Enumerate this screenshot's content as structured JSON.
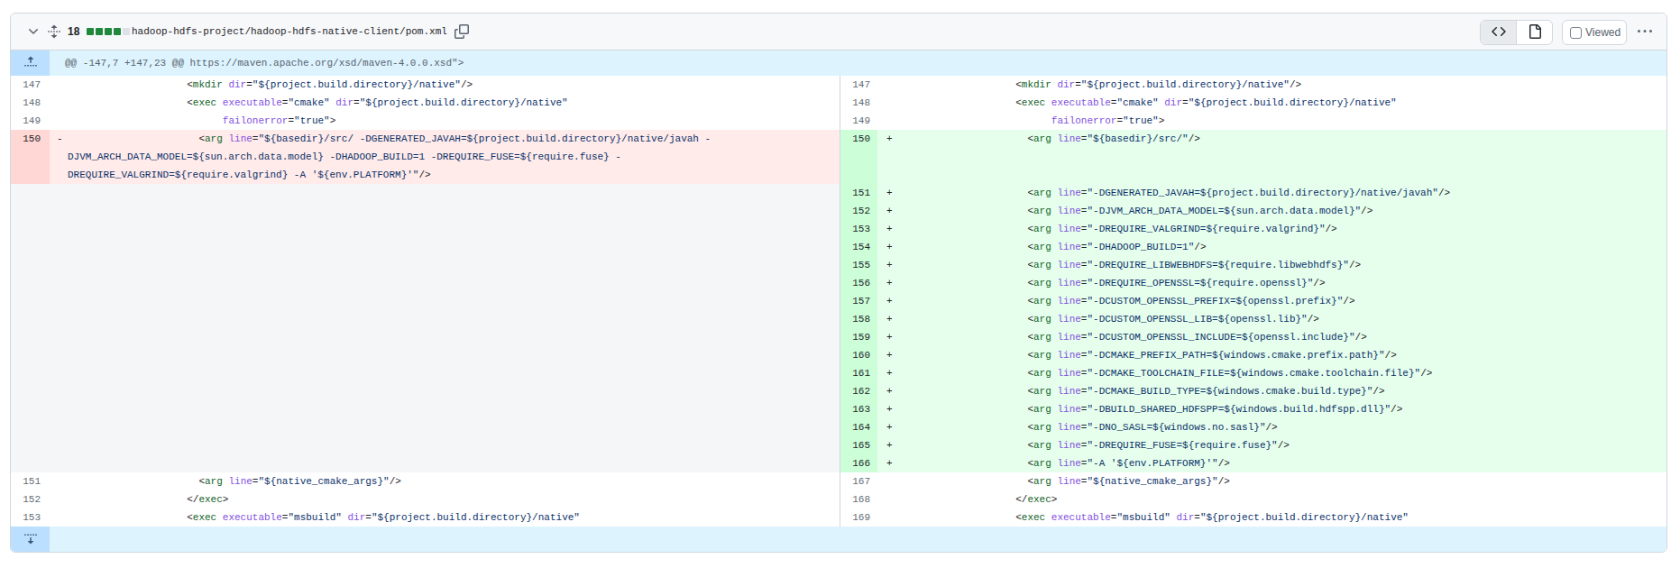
{
  "file_header": {
    "changes_count": "18",
    "diffstat_blocks": [
      "added",
      "added",
      "added",
      "added",
      "neutral"
    ],
    "file_path": "hadoop-hdfs-project/hadoop-hdfs-native-client/pom.xml",
    "viewed_label": "Viewed",
    "icons": [
      "chevron-down-icon",
      "unfold-icon",
      "copy-icon",
      "code-view-icon",
      "rich-diff-icon",
      "kebab-horizontal-icon"
    ]
  },
  "colors": {
    "border": "#d0d7de",
    "header_bg": "#f6f8fa",
    "diffstat_added": "#1f883d",
    "diffstat_neutral": "#dde2e8",
    "hunk_bg": "#ddf4ff",
    "hunk_gutter_bg": "#bbdfff",
    "addition_line_bg": "#e6ffec",
    "addition_num_bg": "#ccffd8",
    "deletion_line_bg": "#ffebe9",
    "deletion_num_bg": "#ffd7d5",
    "empty_cell_bg": "#f4f6f8",
    "syntax_tag": "#116329",
    "syntax_attr": "#8250df",
    "syntax_string": "#0a3069",
    "syntax_punct": "#1f2328"
  },
  "diff_rows": [
    {
      "type": "hunk",
      "text": "@@ -147,7 +147,23 @@ https://maven.apache.org/xsd/maven-4.0.0.xsd\">"
    },
    {
      "type": "pair",
      "left": {
        "num": "147",
        "kind": "ctx",
        "lines": [
          "                    <mkdir dir=\"${project.build.directory}/native\"/>"
        ]
      },
      "right": {
        "num": "147",
        "kind": "ctx",
        "lines": [
          "                    <mkdir dir=\"${project.build.directory}/native\"/>"
        ]
      }
    },
    {
      "type": "pair",
      "left": {
        "num": "148",
        "kind": "ctx",
        "lines": [
          "                    <exec executable=\"cmake\" dir=\"${project.build.directory}/native\""
        ]
      },
      "right": {
        "num": "148",
        "kind": "ctx",
        "lines": [
          "                    <exec executable=\"cmake\" dir=\"${project.build.directory}/native\""
        ]
      }
    },
    {
      "type": "pair",
      "left": {
        "num": "149",
        "kind": "ctx",
        "lines": [
          "                          failonerror=\"true\">"
        ]
      },
      "right": {
        "num": "149",
        "kind": "ctx",
        "lines": [
          "                          failonerror=\"true\">"
        ]
      }
    },
    {
      "type": "pair",
      "left": {
        "num": "150",
        "kind": "del",
        "marker": "-",
        "lines": [
          "                      <arg line=\"${basedir}/src/ -DGENERATED_JAVAH=${project.build.directory}/native/javah -",
          "DJVM_ARCH_DATA_MODEL=${sun.arch.data.model} -DHADOOP_BUILD=1 -DREQUIRE_FUSE=${require.fuse} -",
          "DREQUIRE_VALGRIND=${require.valgrind} -A '${env.PLATFORM}'\"/>"
        ]
      },
      "right": {
        "num": "150",
        "kind": "add",
        "marker": "+",
        "lines": [
          "                      <arg line=\"${basedir}/src/\"/>"
        ]
      }
    },
    {
      "type": "pair",
      "left": {
        "kind": "empty",
        "lines": []
      },
      "right": {
        "num": "151",
        "kind": "add",
        "marker": "+",
        "lines": [
          "                      <arg line=\"-DGENERATED_JAVAH=${project.build.directory}/native/javah\"/>"
        ]
      }
    },
    {
      "type": "pair",
      "left": {
        "kind": "empty",
        "lines": []
      },
      "right": {
        "num": "152",
        "kind": "add",
        "marker": "+",
        "lines": [
          "                      <arg line=\"-DJVM_ARCH_DATA_MODEL=${sun.arch.data.model}\"/>"
        ]
      }
    },
    {
      "type": "pair",
      "left": {
        "kind": "empty",
        "lines": []
      },
      "right": {
        "num": "153",
        "kind": "add",
        "marker": "+",
        "lines": [
          "                      <arg line=\"-DREQUIRE_VALGRIND=${require.valgrind}\"/>"
        ]
      }
    },
    {
      "type": "pair",
      "left": {
        "kind": "empty",
        "lines": []
      },
      "right": {
        "num": "154",
        "kind": "add",
        "marker": "+",
        "lines": [
          "                      <arg line=\"-DHADOOP_BUILD=1\"/>"
        ]
      }
    },
    {
      "type": "pair",
      "left": {
        "kind": "empty",
        "lines": []
      },
      "right": {
        "num": "155",
        "kind": "add",
        "marker": "+",
        "lines": [
          "                      <arg line=\"-DREQUIRE_LIBWEBHDFS=${require.libwebhdfs}\"/>"
        ]
      }
    },
    {
      "type": "pair",
      "left": {
        "kind": "empty",
        "lines": []
      },
      "right": {
        "num": "156",
        "kind": "add",
        "marker": "+",
        "lines": [
          "                      <arg line=\"-DREQUIRE_OPENSSL=${require.openssl}\"/>"
        ]
      }
    },
    {
      "type": "pair",
      "left": {
        "kind": "empty",
        "lines": []
      },
      "right": {
        "num": "157",
        "kind": "add",
        "marker": "+",
        "lines": [
          "                      <arg line=\"-DCUSTOM_OPENSSL_PREFIX=${openssl.prefix}\"/>"
        ]
      }
    },
    {
      "type": "pair",
      "left": {
        "kind": "empty",
        "lines": []
      },
      "right": {
        "num": "158",
        "kind": "add",
        "marker": "+",
        "lines": [
          "                      <arg line=\"-DCUSTOM_OPENSSL_LIB=${openssl.lib}\"/>"
        ]
      }
    },
    {
      "type": "pair",
      "left": {
        "kind": "empty",
        "lines": []
      },
      "right": {
        "num": "159",
        "kind": "add",
        "marker": "+",
        "lines": [
          "                      <arg line=\"-DCUSTOM_OPENSSL_INCLUDE=${openssl.include}\"/>"
        ]
      }
    },
    {
      "type": "pair",
      "left": {
        "kind": "empty",
        "lines": []
      },
      "right": {
        "num": "160",
        "kind": "add",
        "marker": "+",
        "lines": [
          "                      <arg line=\"-DCMAKE_PREFIX_PATH=${windows.cmake.prefix.path}\"/>"
        ]
      }
    },
    {
      "type": "pair",
      "left": {
        "kind": "empty",
        "lines": []
      },
      "right": {
        "num": "161",
        "kind": "add",
        "marker": "+",
        "lines": [
          "                      <arg line=\"-DCMAKE_TOOLCHAIN_FILE=${windows.cmake.toolchain.file}\"/>"
        ]
      }
    },
    {
      "type": "pair",
      "left": {
        "kind": "empty",
        "lines": []
      },
      "right": {
        "num": "162",
        "kind": "add",
        "marker": "+",
        "lines": [
          "                      <arg line=\"-DCMAKE_BUILD_TYPE=${windows.cmake.build.type}\"/>"
        ]
      }
    },
    {
      "type": "pair",
      "left": {
        "kind": "empty",
        "lines": []
      },
      "right": {
        "num": "163",
        "kind": "add",
        "marker": "+",
        "lines": [
          "                      <arg line=\"-DBUILD_SHARED_HDFSPP=${windows.build.hdfspp.dll}\"/>"
        ]
      }
    },
    {
      "type": "pair",
      "left": {
        "kind": "empty",
        "lines": []
      },
      "right": {
        "num": "164",
        "kind": "add",
        "marker": "+",
        "lines": [
          "                      <arg line=\"-DNO_SASL=${windows.no.sasl}\"/>"
        ]
      }
    },
    {
      "type": "pair",
      "left": {
        "kind": "empty",
        "lines": []
      },
      "right": {
        "num": "165",
        "kind": "add",
        "marker": "+",
        "lines": [
          "                      <arg line=\"-DREQUIRE_FUSE=${require.fuse}\"/>"
        ]
      }
    },
    {
      "type": "pair",
      "left": {
        "kind": "empty",
        "lines": []
      },
      "right": {
        "num": "166",
        "kind": "add",
        "marker": "+",
        "lines": [
          "                      <arg line=\"-A '${env.PLATFORM}'\"/>"
        ]
      }
    },
    {
      "type": "pair",
      "left": {
        "num": "151",
        "kind": "ctx",
        "lines": [
          "                      <arg line=\"${native_cmake_args}\"/>"
        ]
      },
      "right": {
        "num": "167",
        "kind": "ctx",
        "lines": [
          "                      <arg line=\"${native_cmake_args}\"/>"
        ]
      }
    },
    {
      "type": "pair",
      "left": {
        "num": "152",
        "kind": "ctx",
        "lines": [
          "                    </exec>"
        ]
      },
      "right": {
        "num": "168",
        "kind": "ctx",
        "lines": [
          "                    </exec>"
        ]
      }
    },
    {
      "type": "pair",
      "left": {
        "num": "153",
        "kind": "ctx",
        "lines": [
          "                    <exec executable=\"msbuild\" dir=\"${project.build.directory}/native\""
        ]
      },
      "right": {
        "num": "169",
        "kind": "ctx",
        "lines": [
          "                    <exec executable=\"msbuild\" dir=\"${project.build.directory}/native\""
        ]
      }
    },
    {
      "type": "expand",
      "text": ""
    }
  ]
}
